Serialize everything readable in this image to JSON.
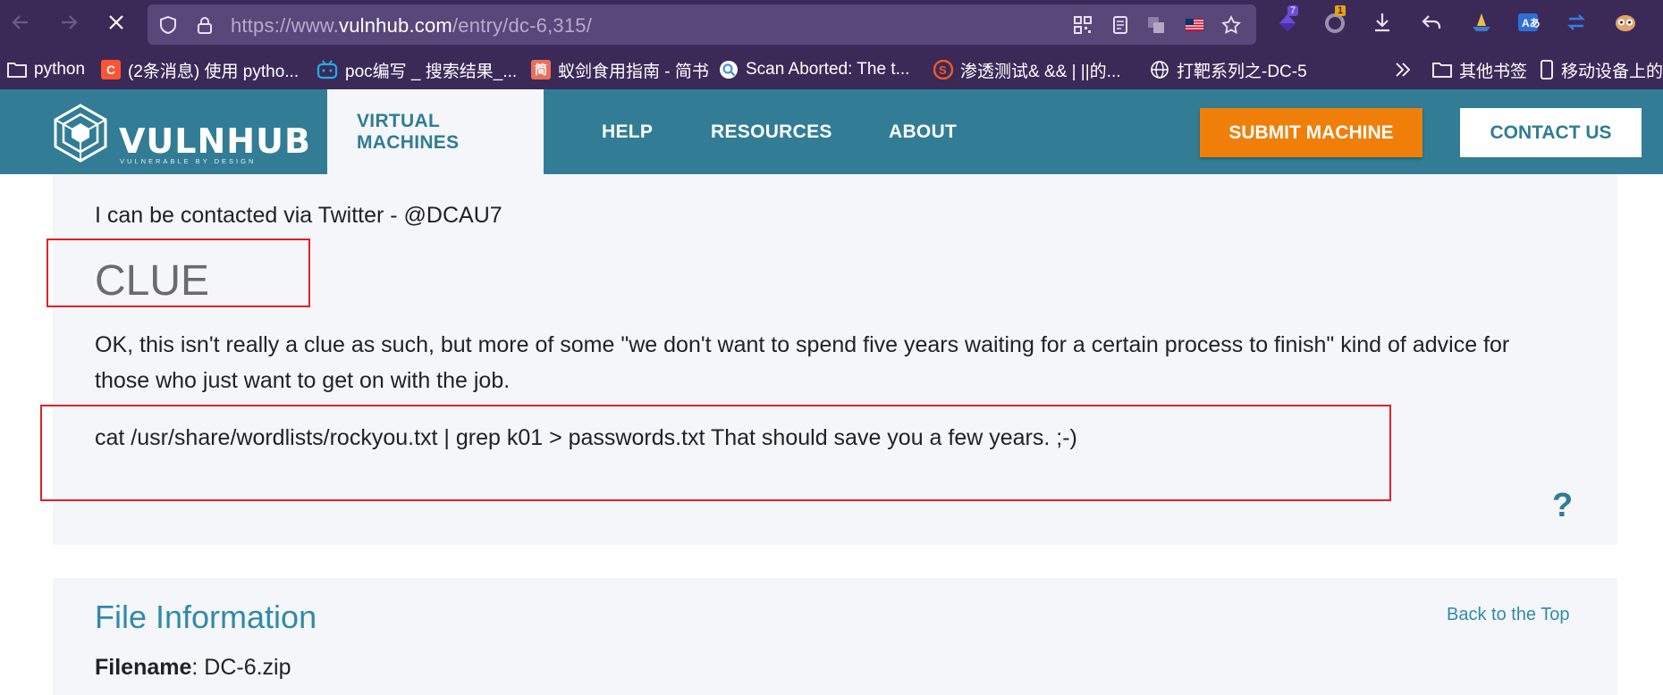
{
  "browser": {
    "url_prefix": "https://www.",
    "url_domain": "vulnhub.com",
    "url_path": "/entry/dc-6,315/",
    "ext_badges": {
      "ext1": "7",
      "ext2": "1"
    }
  },
  "bookmarks": [
    {
      "label": "python",
      "icon": "folder-icon"
    },
    {
      "label": "(2条消息) 使用 pytho...",
      "icon": "csdn-icon",
      "glyph": "C",
      "color": "#fc5531"
    },
    {
      "label": "poc编写 _ 搜索结果_...",
      "icon": "bilibili-icon",
      "glyph": "",
      "color": "#23ade5"
    },
    {
      "label": "蚁剑食用指南 - 简书",
      "icon": "jianshu-icon",
      "glyph": "简",
      "color": "#ea6f5a"
    },
    {
      "label": "Scan Aborted: The t...",
      "icon": "search-icon",
      "glyph": "",
      "color": "#4a90e2"
    },
    {
      "label": "渗透测试& &&  | ||的...",
      "icon": "s-logo-icon",
      "glyph": "S",
      "color": "#f05a28"
    },
    {
      "label": "打靶系列之-DC-5",
      "icon": "globe-icon",
      "glyph": "",
      "color": ""
    }
  ],
  "bookmarks_right": [
    {
      "label": "其他书签",
      "icon": "folder-icon"
    },
    {
      "label": "移动设备上的书签",
      "icon": "mobile-icon"
    }
  ],
  "site": {
    "logo_text": "VULNHUB",
    "logo_tagline": "VULNERABLE BY DESIGN",
    "nav": [
      "VIRTUAL MACHINES",
      "HELP",
      "RESOURCES",
      "ABOUT"
    ],
    "submit_label": "SUBMIT MACHINE",
    "contact_label": "CONTACT US"
  },
  "content": {
    "contact_line": "I can be contacted via Twitter - @DCAU7",
    "clue_heading": "CLUE",
    "clue_para": "OK, this isn't really a clue as such, but more of some \"we don't want to spend five years waiting for a certain process to finish\" kind of advice for those who just want to get on with the job.",
    "command": "cat /usr/share/wordlists/rockyou.txt | grep k01 > passwords.txt That should save you a few years. ;-)",
    "help_symbol": "?",
    "file_info_title": "File Information",
    "back_to_top": "Back to the Top",
    "filename_label": "Filename",
    "filename_value": ": DC-6.zip"
  },
  "colors": {
    "header_bg": "#327d95",
    "accent_orange": "#f07f09",
    "highlight_red": "#e0202a",
    "browser_bg": "#3b2a58"
  }
}
